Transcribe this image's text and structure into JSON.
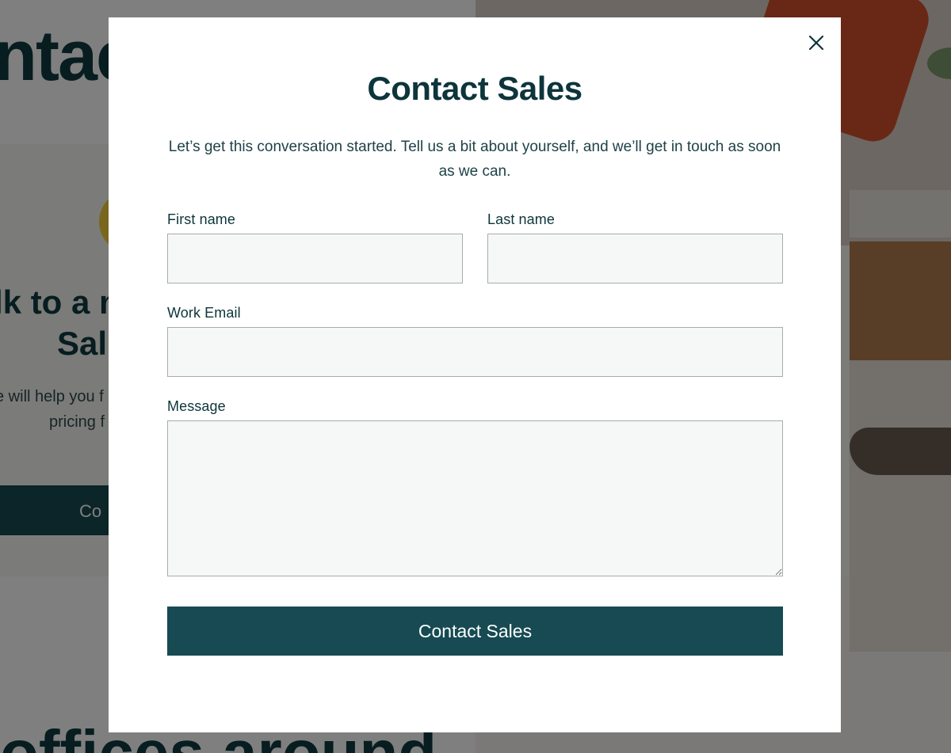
{
  "background": {
    "heading": "ntac",
    "subheading_line1": "lk to a m",
    "subheading_line2": "Sal",
    "paragraph_line1": "e will help you f",
    "paragraph_line2": "pricing f",
    "button_label": "Co",
    "bottom_heading": "offices around"
  },
  "modal": {
    "close_icon": "close-icon",
    "title": "Contact Sales",
    "intro": "Let’s get this conversation started. Tell us a bit about yourself, and we’ll get in touch as soon as we can.",
    "fields": {
      "first_name": {
        "label": "First name",
        "value": "",
        "placeholder": ""
      },
      "last_name": {
        "label": "Last name",
        "value": "",
        "placeholder": ""
      },
      "work_email": {
        "label": "Work Email",
        "value": "",
        "placeholder": ""
      },
      "message": {
        "label": "Message",
        "value": "",
        "placeholder": ""
      }
    },
    "submit_label": "Contact Sales"
  },
  "colors": {
    "brand_dark": "#174a52",
    "heading_text": "#0d353b",
    "input_background": "#f6f8f7",
    "input_border": "#a8acab",
    "overlay": "rgba(0,0,0,0.5)"
  }
}
